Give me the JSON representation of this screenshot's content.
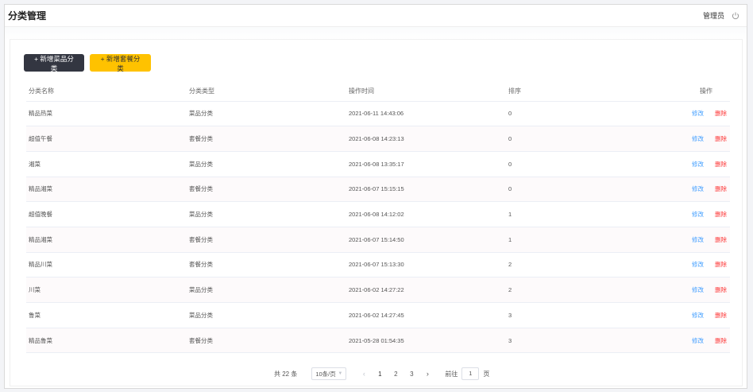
{
  "header": {
    "title": "分类管理",
    "user": "管理员"
  },
  "toolbar": {
    "add_dish_category": "+ 新增菜品分类",
    "add_combo_category": "+ 新增套餐分类"
  },
  "table": {
    "columns": [
      "分类名称",
      "分类类型",
      "操作时间",
      "排序",
      "操作"
    ],
    "rows": [
      {
        "name": "精品热菜",
        "type": "菜品分类",
        "time": "2021-06-11 14:43:06",
        "sort": "0"
      },
      {
        "name": "超值午餐",
        "type": "套餐分类",
        "time": "2021-06-08 14:23:13",
        "sort": "0"
      },
      {
        "name": "湘菜",
        "type": "菜品分类",
        "time": "2021-06-08 13:35:17",
        "sort": "0"
      },
      {
        "name": "精品湘菜",
        "type": "套餐分类",
        "time": "2021-06-07 15:15:15",
        "sort": "0"
      },
      {
        "name": "超值晚餐",
        "type": "菜品分类",
        "time": "2021-06-08 14:12:02",
        "sort": "1"
      },
      {
        "name": "精品湘菜",
        "type": "套餐分类",
        "time": "2021-06-07 15:14:50",
        "sort": "1"
      },
      {
        "name": "精品川菜",
        "type": "套餐分类",
        "time": "2021-06-07 15:13:30",
        "sort": "2"
      },
      {
        "name": "川菜",
        "type": "菜品分类",
        "time": "2021-06-02 14:27:22",
        "sort": "2"
      },
      {
        "name": "鲁菜",
        "type": "菜品分类",
        "time": "2021-06-02 14:27:45",
        "sort": "3"
      },
      {
        "name": "精品鲁菜",
        "type": "套餐分类",
        "time": "2021-05-28 01:54:35",
        "sort": "3"
      }
    ],
    "edit_label": "修改",
    "delete_label": "删除"
  },
  "pagination": {
    "total": "共 22 条",
    "page_size": "10条/页",
    "pages": [
      "1",
      "2",
      "3"
    ],
    "current_page": "1",
    "goto_label": "前往",
    "goto_value": "1",
    "goto_suffix": "页"
  },
  "colors": {
    "dark_button": "#333641",
    "accent_yellow": "#ffc200",
    "edit_link": "#419eff",
    "delete_link": "#fd3333"
  }
}
